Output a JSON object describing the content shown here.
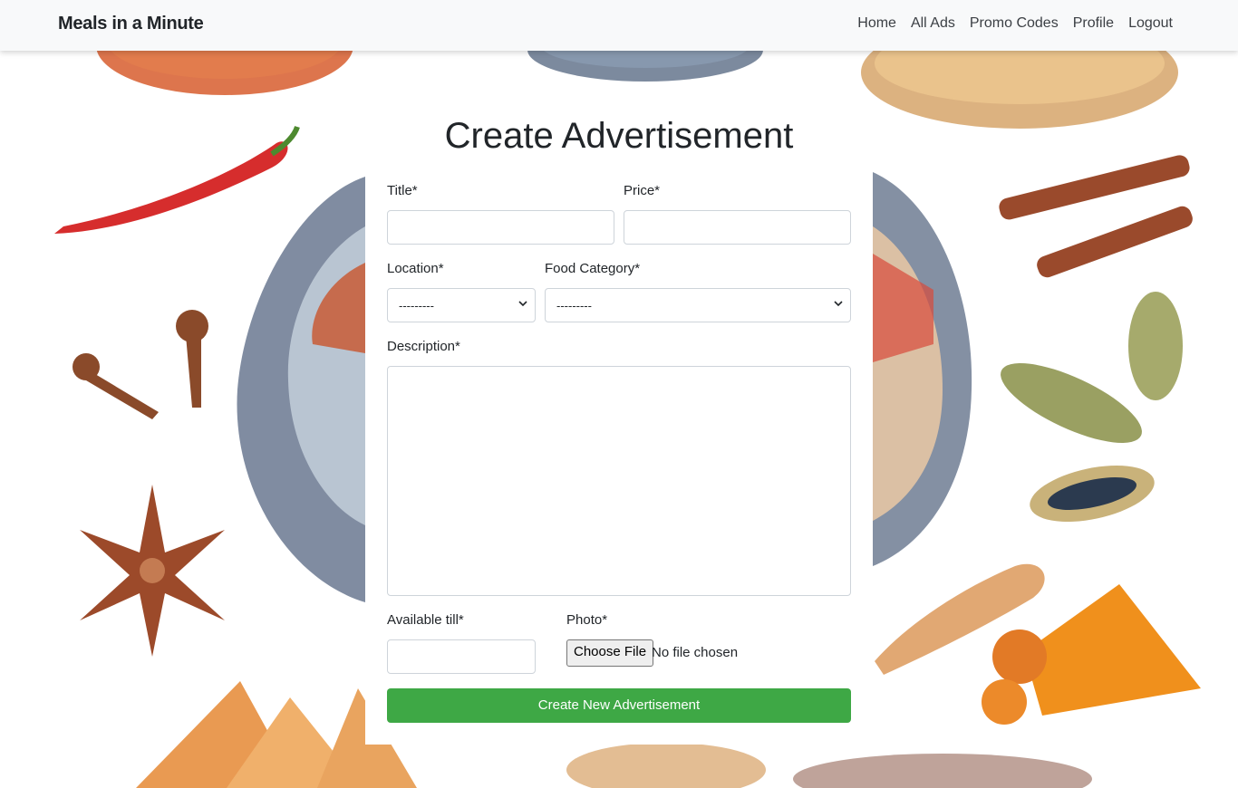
{
  "navbar": {
    "brand": "Meals in a Minute",
    "links": [
      "Home",
      "All Ads",
      "Promo Codes",
      "Profile",
      "Logout"
    ]
  },
  "form": {
    "title": "Create Advertisement",
    "fields": {
      "title_label": "Title*",
      "title_value": "",
      "price_label": "Price*",
      "price_value": "",
      "location_label": "Location*",
      "location_selected": "---------",
      "category_label": "Food Category*",
      "category_selected": "---------",
      "description_label": "Description*",
      "description_value": "",
      "available_label": "Available till*",
      "available_value": "",
      "photo_label": "Photo*",
      "photo_button": "Choose File",
      "photo_status": "No file chosen"
    },
    "submit_label": "Create New Advertisement"
  },
  "colors": {
    "navbar_bg": "#f8f9fa",
    "submit_bg": "#3ea845",
    "border": "#ced4da"
  },
  "icons": [
    "chevron-down-icon"
  ]
}
